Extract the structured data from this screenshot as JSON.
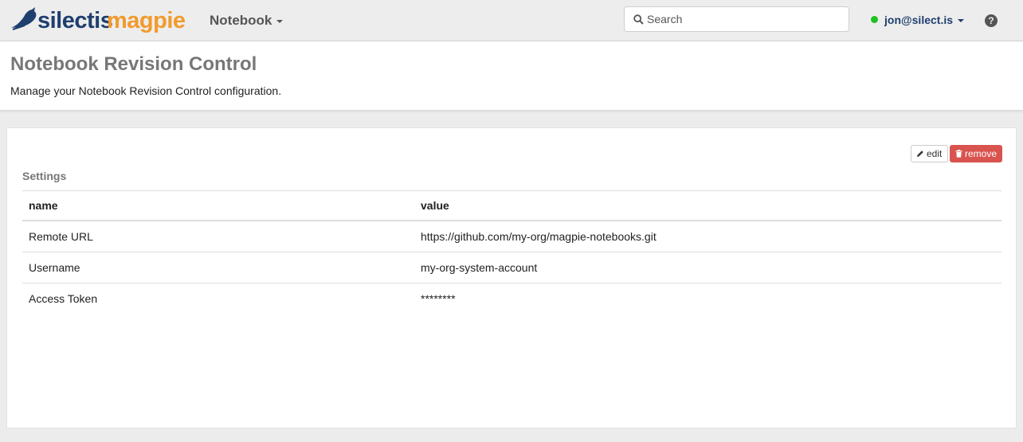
{
  "brand": {
    "part1": "silectis",
    "part2": "magpie"
  },
  "nav": {
    "notebook_label": "Notebook"
  },
  "search": {
    "placeholder": "Search"
  },
  "user": {
    "name": "jon@silect.is",
    "status_color": "#1fc11f"
  },
  "help": {
    "glyph": "?"
  },
  "page": {
    "title": "Notebook Revision Control",
    "description": "Manage your Notebook Revision Control configuration."
  },
  "actions": {
    "edit_label": "edit",
    "remove_label": "remove"
  },
  "settings": {
    "title": "Settings",
    "columns": [
      "name",
      "value"
    ],
    "rows": [
      {
        "name": "Remote URL",
        "value": "https://github.com/my-org/magpie-notebooks.git"
      },
      {
        "name": "Username",
        "value": "my-org-system-account"
      },
      {
        "name": "Access Token",
        "value": "********"
      }
    ]
  },
  "colors": {
    "brand_dark": "#1f3f6e",
    "brand_orange": "#f29a2e",
    "danger": "#d9534f"
  }
}
